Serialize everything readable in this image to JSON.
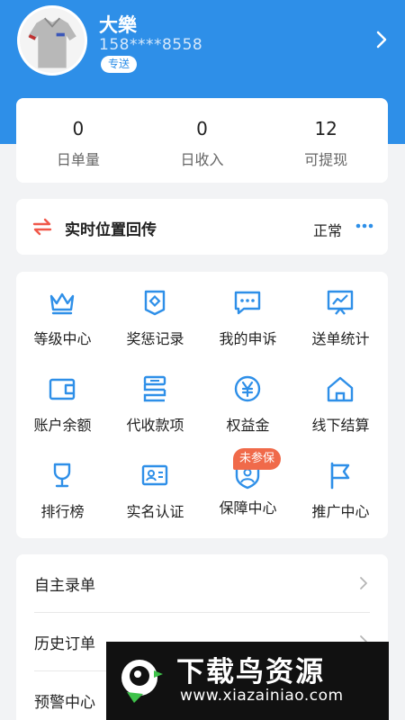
{
  "profile": {
    "name": "大樂",
    "phone": "158****8558",
    "tag": "专送",
    "avatar_icon": "polo-shirt-avatar",
    "arrow_icon": "chevron-right-icon"
  },
  "stats": [
    {
      "value": "0",
      "label": "日单量"
    },
    {
      "value": "0",
      "label": "日收入"
    },
    {
      "value": "12",
      "label": "可提现"
    }
  ],
  "location": {
    "icon": "transfer-arrows-icon",
    "title": "实时位置回传",
    "status": "正常",
    "more_icon": "more-dots-icon"
  },
  "grid": [
    {
      "label": "等级中心",
      "icon": "crown-icon"
    },
    {
      "label": "奖惩记录",
      "icon": "shield-doc-icon"
    },
    {
      "label": "我的申诉",
      "icon": "chat-bubble-icon"
    },
    {
      "label": "送单统计",
      "icon": "chart-board-icon"
    },
    {
      "label": "账户余额",
      "icon": "wallet-icon"
    },
    {
      "label": "代收款项",
      "icon": "stack-coins-icon"
    },
    {
      "label": "权益金",
      "icon": "yuan-coin-icon"
    },
    {
      "label": "线下结算",
      "icon": "home-icon"
    },
    {
      "label": "排行榜",
      "icon": "trophy-icon"
    },
    {
      "label": "实名认证",
      "icon": "id-card-icon"
    },
    {
      "label": "保障中心",
      "icon": "shield-user-icon"
    },
    {
      "label": "推广中心",
      "icon": "flag-icon"
    }
  ],
  "insurance_badge": "未参保",
  "menu": [
    {
      "label": "自主录单"
    },
    {
      "label": "历史订单"
    },
    {
      "label": "预警中心"
    }
  ],
  "watermark": {
    "title": "下载鸟资源",
    "url": "www.xiazainiao.com"
  },
  "colors": {
    "brand": "#2e8fe8",
    "badge": "#f06a4a",
    "location_icon": "#f0584a"
  }
}
